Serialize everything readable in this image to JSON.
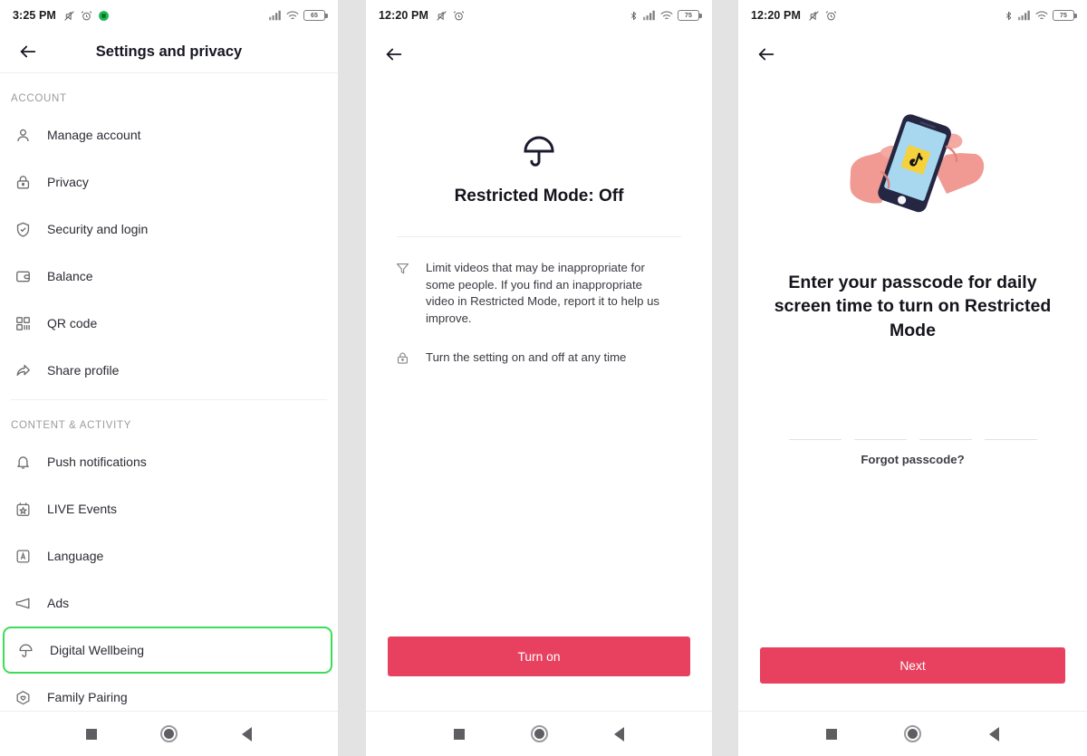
{
  "panels": [
    {
      "id": "settings-and-privacy",
      "statusbar": {
        "time": "3:25 PM",
        "icons_left": [
          "mute-icon",
          "alarm-icon",
          "app-badge-icon"
        ],
        "icons_right": [
          "signal-icon",
          "wifi-icon",
          "battery-icon"
        ],
        "battery_level": "65",
        "bluetooth": false
      },
      "appbar": {
        "title": "Settings and privacy",
        "back_icon": "back-arrow-icon"
      },
      "sections": [
        {
          "header": "ACCOUNT",
          "items": [
            {
              "label": "Manage account",
              "icon": "person-icon",
              "highlighted": false
            },
            {
              "label": "Privacy",
              "icon": "lock-icon",
              "highlighted": false
            },
            {
              "label": "Security and login",
              "icon": "shield-icon",
              "highlighted": false
            },
            {
              "label": "Balance",
              "icon": "wallet-icon",
              "highlighted": false
            },
            {
              "label": "QR code",
              "icon": "qr-code-icon",
              "highlighted": false
            },
            {
              "label": "Share profile",
              "icon": "share-icon",
              "highlighted": false
            }
          ]
        },
        {
          "header": "CONTENT & ACTIVITY",
          "items": [
            {
              "label": "Push notifications",
              "icon": "bell-icon",
              "highlighted": false
            },
            {
              "label": "LIVE Events",
              "icon": "calendar-icon",
              "highlighted": false
            },
            {
              "label": "Language",
              "icon": "language-icon",
              "highlighted": false
            },
            {
              "label": "Ads",
              "icon": "megaphone-icon",
              "highlighted": false
            },
            {
              "label": "Digital Wellbeing",
              "icon": "umbrella-icon",
              "highlighted": true
            },
            {
              "label": "Family Pairing",
              "icon": "family-icon",
              "highlighted": false
            }
          ]
        }
      ],
      "highlight_color": "#3ddc58"
    },
    {
      "id": "restricted-mode",
      "statusbar": {
        "time": "12:20 PM",
        "icons_left": [
          "mute-icon",
          "alarm-icon"
        ],
        "icons_right": [
          "bluetooth-icon",
          "signal-icon",
          "wifi-icon",
          "battery-icon"
        ],
        "battery_level": "75",
        "bluetooth": true
      },
      "appbar": {
        "title": "",
        "back_icon": "back-arrow-icon"
      },
      "hero_icon": "umbrella-icon",
      "title": "Restricted Mode: Off",
      "bullets": [
        {
          "icon": "filter-icon",
          "text": "Limit videos that may be inappropriate for some people. If you find an inappropriate video in Restricted Mode, report it to help us improve."
        },
        {
          "icon": "lock-icon",
          "text": "Turn the setting on and off at any time"
        }
      ],
      "cta_label": "Turn on",
      "cta_color": "#e84160"
    },
    {
      "id": "enter-passcode",
      "statusbar": {
        "time": "12:20 PM",
        "icons_left": [
          "mute-icon",
          "alarm-icon"
        ],
        "icons_right": [
          "bluetooth-icon",
          "signal-icon",
          "wifi-icon",
          "battery-icon"
        ],
        "battery_level": "75",
        "bluetooth": true
      },
      "appbar": {
        "title": "",
        "back_icon": "back-arrow-icon"
      },
      "illustration": "hand-holding-phone-illustration",
      "title": "Enter your passcode for daily screen time to turn on Restricted Mode",
      "passcode_slots": 4,
      "passcode_value": "",
      "forgot_label": "Forgot passcode?",
      "cta_label": "Next",
      "cta_color": "#e84160"
    }
  ],
  "navbar": {
    "recent": "square-icon",
    "home": "circle-icon",
    "back": "triangle-back-icon"
  }
}
